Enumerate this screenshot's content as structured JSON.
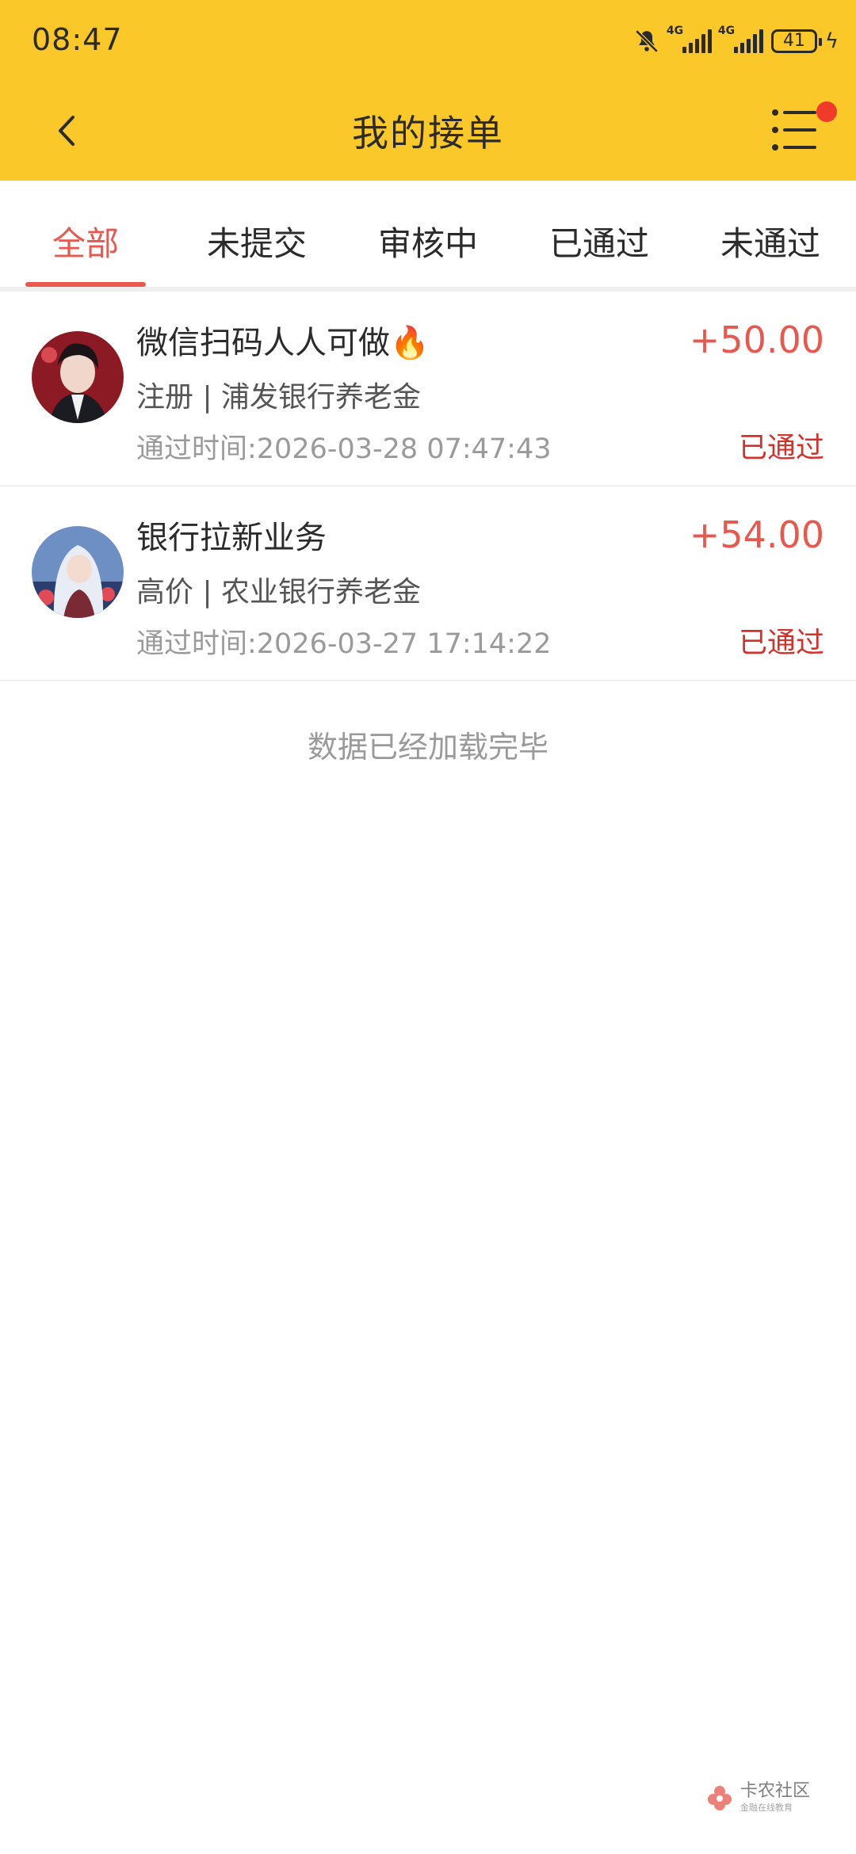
{
  "status_bar": {
    "time": "08:47",
    "network1": "4G",
    "network2": "4G",
    "battery": "41"
  },
  "header": {
    "title": "我的接单"
  },
  "tabs": [
    {
      "label": "全部",
      "active": true
    },
    {
      "label": "未提交",
      "active": false
    },
    {
      "label": "审核中",
      "active": false
    },
    {
      "label": "已通过",
      "active": false
    },
    {
      "label": "未通过",
      "active": false
    }
  ],
  "orders": [
    {
      "title": "微信扫码人人可做",
      "emoji": "🔥",
      "subtitle": "注册 | 浦发银行养老金",
      "time": "通过时间:2026-03-28 07:47:43",
      "amount": "+50.00",
      "status": "已通过"
    },
    {
      "title": "银行拉新业务",
      "subtitle": "高价 | 农业银行养老金",
      "time": "通过时间:2026-03-27 17:14:22",
      "amount": "+54.00",
      "status": "已通过"
    }
  ],
  "footer": {
    "end_text": "数据已经加载完毕"
  },
  "watermark": {
    "name": "卡农社区",
    "tagline": "金融在线教育"
  },
  "colors": {
    "header_bg": "#fbc82a",
    "accent": "#e8584e",
    "status_red": "#d6302a",
    "notification_dot": "#f03a2a"
  }
}
